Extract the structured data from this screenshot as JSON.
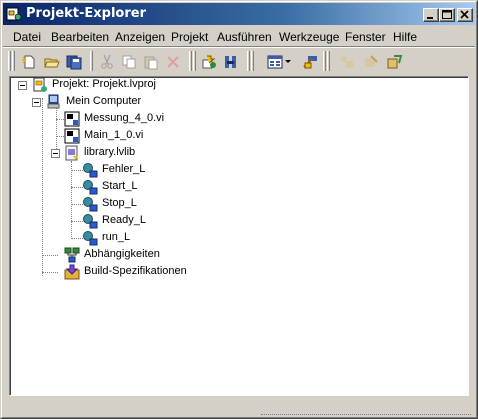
{
  "window": {
    "title": "Projekt-Explorer"
  },
  "menu": [
    {
      "label": "Datei"
    },
    {
      "label": "Bearbeiten"
    },
    {
      "label": "Anzeigen"
    },
    {
      "label": "Projekt"
    },
    {
      "label": "Ausführen"
    },
    {
      "label": "Werkzeuge"
    },
    {
      "label": "Fenster"
    },
    {
      "label": "Hilfe"
    }
  ],
  "toolbar": {
    "icons": [
      "new-icon",
      "open-icon",
      "save-all-icon",
      "cut-icon",
      "copy-icon",
      "paste-icon",
      "delete-icon",
      "build-icon",
      "deploy-icon",
      "view-icon",
      "view-dropdown-icon",
      "file-settings-icon",
      "expand-icon",
      "collapse-icon",
      "sort-icon"
    ]
  },
  "tree": {
    "project": "Projekt: Projekt.lvproj",
    "computer": "Mein Computer",
    "vi1": "Messung_4_0.vi",
    "vi2": "Main_1_0.vi",
    "library": "library.lvlib",
    "vars": [
      "Fehler_L",
      "Start_L",
      "Stop_L",
      "Ready_L",
      "run_L"
    ],
    "dependencies": "Abhängigkeiten",
    "build": "Build-Spezifikationen"
  },
  "colors": {
    "titlebar_start": "#0a246a",
    "titlebar_end": "#a6caf0",
    "face": "#d4d0c8"
  }
}
